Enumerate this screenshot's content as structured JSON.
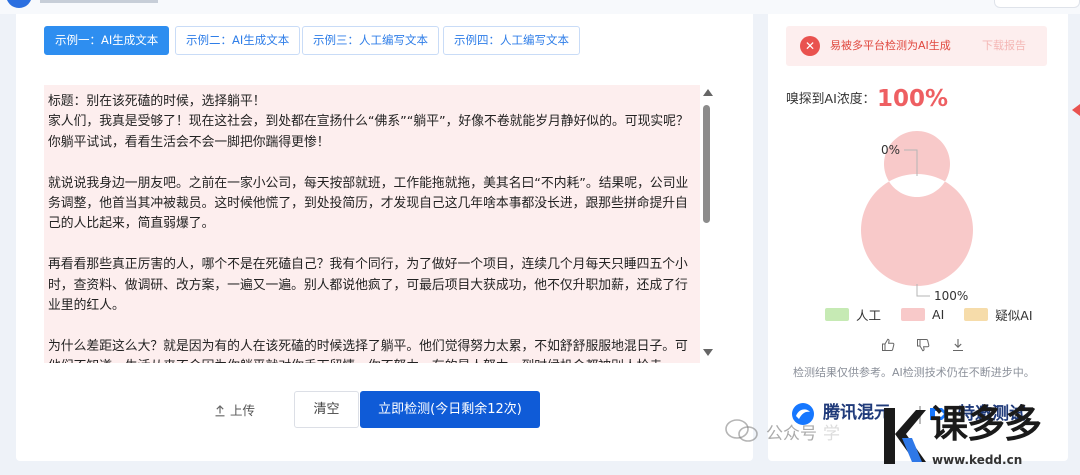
{
  "tabs": [
    {
      "label": "示例一：AI生成文本",
      "active": true
    },
    {
      "label": "示例二：AI生成文本",
      "active": false
    },
    {
      "label": "示例三：人工编写文本",
      "active": false
    },
    {
      "label": "示例四：人工编写文本",
      "active": false
    }
  ],
  "textarea": {
    "paragraphs": [
      "标题：别在该死磕的时候，选择躺平！",
      "家人们，我真是受够了！现在这社会，到处都在宣扬什么“佛系”“躺平”，好像不卷就能岁月静好似的。可现实呢？你躺平试试，看看生活会不会一脚把你踹得更惨！",
      "",
      "就说说我身边一朋友吧。之前在一家小公司，每天按部就班，工作能拖就拖，美其名曰“不内耗”。结果呢，公司业务调整，他首当其冲被裁员。这时候他慌了，到处投简历，才发现自己这几年啥本事都没长进，跟那些拼命提升自己的人比起来，简直弱爆了。",
      "",
      "再看看那些真正厉害的人，哪个不是在死磕自己？我有个同行，为了做好一个项目，连续几个月每天只睡四五个小时，查资料、做调研、改方案，一遍又一遍。别人都说他疯了，可最后项目大获成功，他不仅升职加薪，还成了行业里的红人。",
      "",
      "为什么差距这么大？就是因为有的人在该死磕的时候选择了躺平。他们觉得努力太累，不如舒舒服服地混日子。可他们不知道，生活从来不会因为你躺平就对你手下留情。你不努力，有的是人努力，到时候机会都被别人抢走"
    ]
  },
  "actions": {
    "upload": "上传",
    "clear": "清空",
    "detect": "立即检测(今日剩余12次)"
  },
  "result": {
    "alert_text": "易被多平台检测为AI生成",
    "alert_link": "下载报告",
    "concentration_label": "嗅探到AI浓度：",
    "concentration_value": "100%",
    "donut": {
      "label_top": "0%",
      "label_bottom": "100%"
    },
    "legend": [
      {
        "label": "人工",
        "color": "#c6eab4"
      },
      {
        "label": "AI",
        "color": "#f8c9c9"
      },
      {
        "label": "疑似AI",
        "color": "#f6dcaa"
      }
    ],
    "disclaimer": "检测结果仅供参考。AI检测技术仍在不断进步中。",
    "partner_1": "腾讯混元",
    "partner_2": "特邀测试"
  },
  "chart_data": {
    "type": "pie",
    "labels": [
      "人工",
      "AI",
      "疑似AI"
    ],
    "values": [
      0,
      100,
      0
    ],
    "colors": [
      "#c6eab4",
      "#f8c9c9",
      "#f6dcaa"
    ]
  },
  "watermark": {
    "text": "公众号",
    "faint_text": "学"
  },
  "site_logo": {
    "name": "课多多",
    "url": "www.kedd.cn"
  }
}
